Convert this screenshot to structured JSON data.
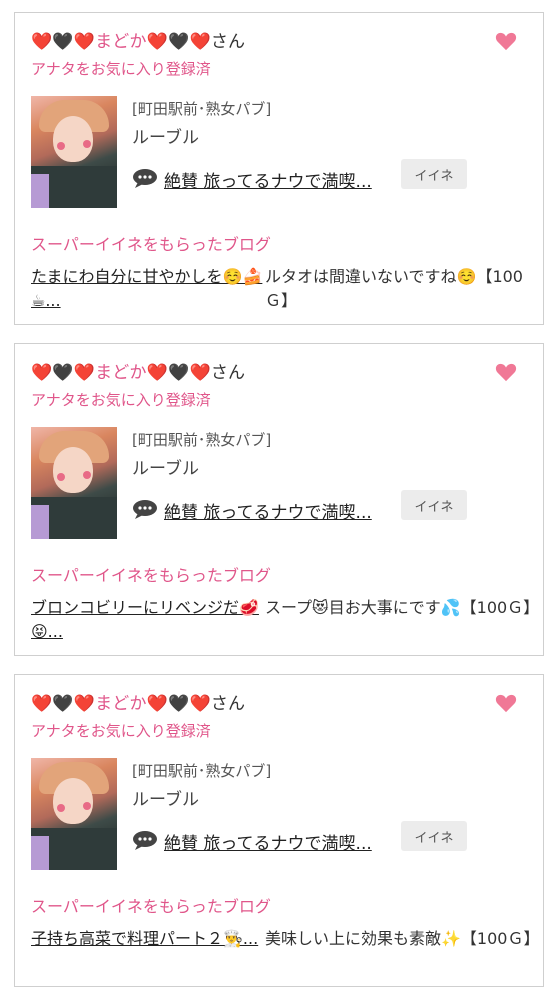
{
  "cards": [
    {
      "user": {
        "prefix": "❤️🖤❤️",
        "name": "まどか",
        "suffix": "❤️🖤❤️",
        "honorific": "さん"
      },
      "favorite_status": "アナタをお気に入り登録済",
      "shop": "[町田駅前･熟女パブ]",
      "cast_name": "ルーブル",
      "comment_link": "絶賛 旅ってるナウで満喫...",
      "iine_button": "イイネ",
      "section_label": "スーパーイイネをもらったブログ",
      "blog_title": "たまにわ自分に甘やかしを☺️🍰☕...",
      "blog_desc": "ルタオは間違いないですね☺️【100Ｇ】"
    },
    {
      "user": {
        "prefix": "❤️🖤❤️",
        "name": "まどか",
        "suffix": "❤️🖤❤️",
        "honorific": "さん"
      },
      "favorite_status": "アナタをお気に入り登録済",
      "shop": "[町田駅前･熟女パブ]",
      "cast_name": "ルーブル",
      "comment_link": "絶賛 旅ってるナウで満喫...",
      "iine_button": "イイネ",
      "section_label": "スーパーイイネをもらったブログ",
      "blog_title": "ブロンコビリーにリベンジだ🥩😝...",
      "blog_desc": "スープ😻目お大事にです💦【100Ｇ】"
    },
    {
      "user": {
        "prefix": "❤️🖤❤️",
        "name": "まどか",
        "suffix": "❤️🖤❤️",
        "honorific": "さん"
      },
      "favorite_status": "アナタをお気に入り登録済",
      "shop": "[町田駅前･熟女パブ]",
      "cast_name": "ルーブル",
      "comment_link": "絶賛 旅ってるナウで満喫...",
      "iine_button": "イイネ",
      "section_label": "スーパーイイネをもらったブログ",
      "blog_title": "子持ち高菜で料理パート２👨‍🍳...",
      "blog_desc": "美味しい上に効果も素敵✨【100Ｇ】"
    }
  ],
  "icons": {
    "favorite": "heart-icon",
    "comment": "speech-bubble-icon"
  },
  "colors": {
    "accent_pink": "#e0568a",
    "heart_pink": "#f07896",
    "border": "#cfcfcf",
    "button_bg": "#ececec"
  }
}
